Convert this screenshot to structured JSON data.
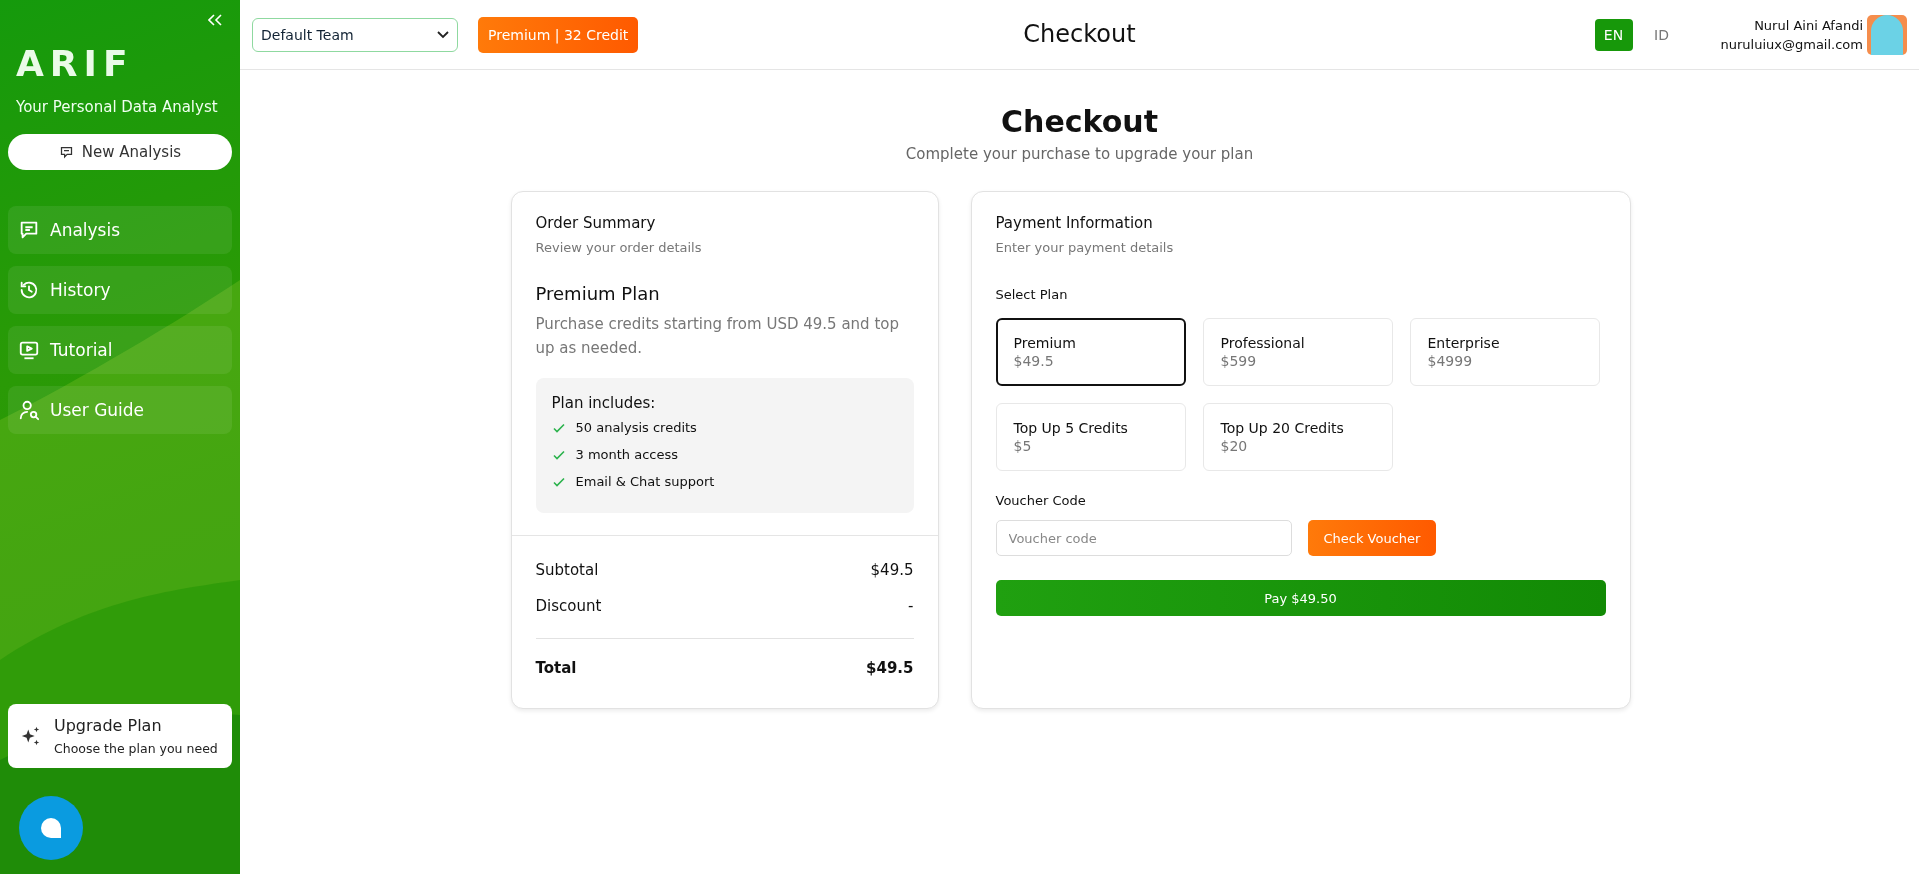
{
  "sidebar": {
    "logo": "ARIF",
    "tagline": "Your Personal Data Analyst",
    "new_button": "New Analysis",
    "items": [
      {
        "label": "Analysis"
      },
      {
        "label": "History"
      },
      {
        "label": "Tutorial"
      },
      {
        "label": "User Guide"
      }
    ],
    "upgrade": {
      "title": "Upgrade Plan",
      "subtitle": "Choose the plan you need"
    }
  },
  "topbar": {
    "team": "Default Team",
    "badge": "Premium | 32 Credit",
    "title": "Checkout",
    "languages": [
      {
        "label": "EN",
        "selected": true
      },
      {
        "label": "ID",
        "selected": false
      }
    ],
    "user": {
      "name": "Nurul Aini Afandi",
      "email": "nuruluiux@gmail.com"
    }
  },
  "page": {
    "title": "Checkout",
    "subtitle": "Complete your purchase to upgrade your plan"
  },
  "order": {
    "title": "Order Summary",
    "subtitle": "Review your order details",
    "plan": "Premium Plan",
    "description": "Purchase credits starting from USD 49.5 and top up as needed.",
    "includes_title": "Plan includes:",
    "includes": [
      "50 analysis credits",
      "3 month access",
      "Email & Chat support"
    ],
    "subtotal": {
      "label": "Subtotal",
      "value": "$49.5"
    },
    "discount": {
      "label": "Discount",
      "value": "-"
    },
    "total": {
      "label": "Total",
      "value": "$49.5"
    }
  },
  "payment": {
    "title": "Payment Information",
    "subtitle": "Enter your payment details",
    "select_label": "Select Plan",
    "plans": [
      {
        "name": "Premium",
        "price": "$49.5",
        "selected": true
      },
      {
        "name": "Professional",
        "price": "$599",
        "selected": false
      },
      {
        "name": "Enterprise",
        "price": "$4999",
        "selected": false
      },
      {
        "name": "Top Up 5 Credits",
        "price": "$5",
        "selected": false
      },
      {
        "name": "Top Up 20 Credits",
        "price": "$20",
        "selected": false
      }
    ],
    "voucher_label": "Voucher Code",
    "voucher_placeholder": "Voucher code",
    "check_button": "Check Voucher",
    "pay_button": "Pay $49.50"
  }
}
